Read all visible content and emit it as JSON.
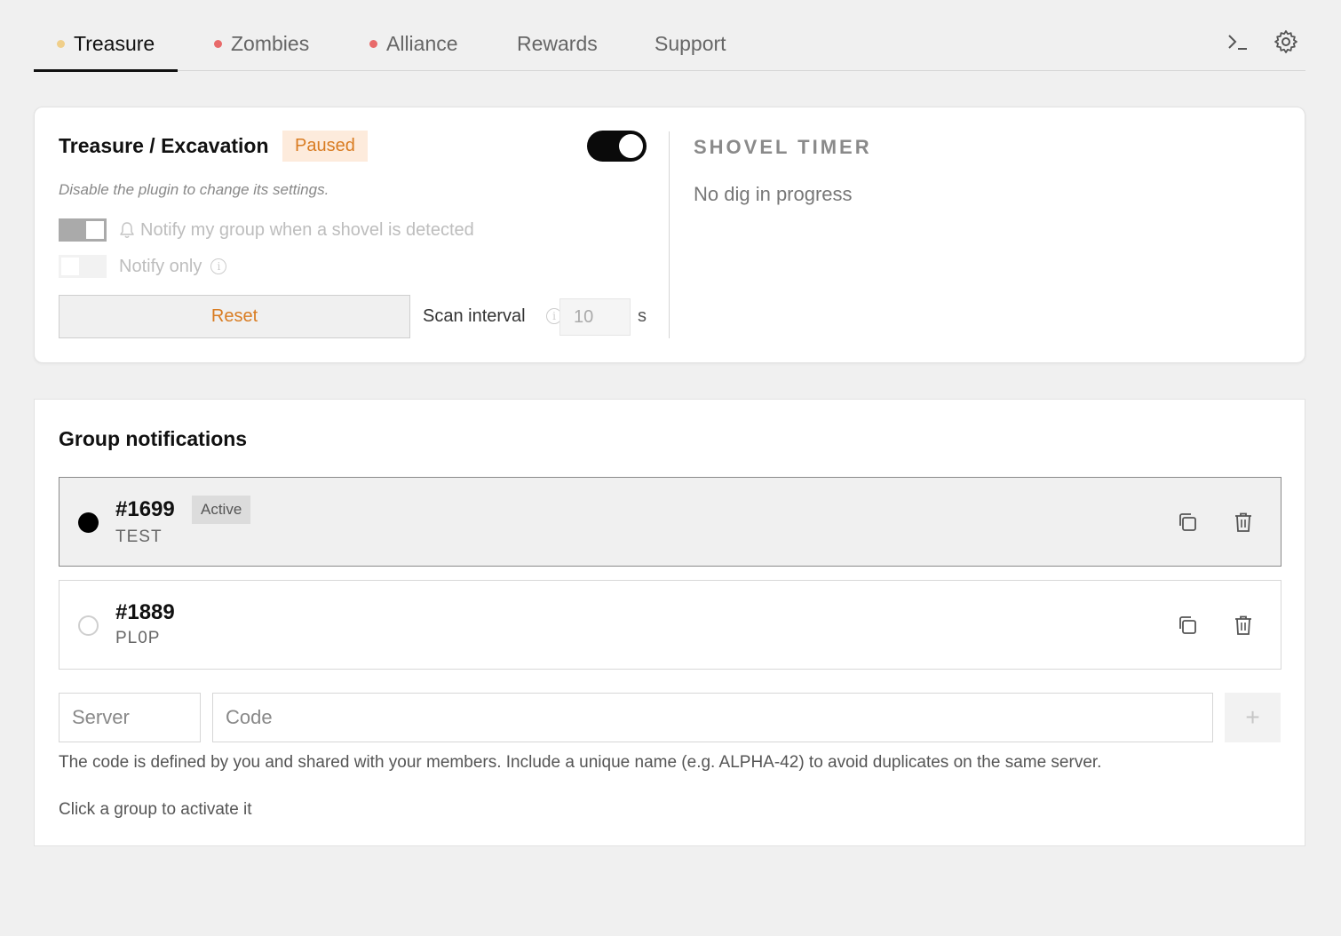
{
  "tabs": [
    {
      "label": "Treasure",
      "dot_color": "#f0cf8a",
      "active": true
    },
    {
      "label": "Zombies",
      "dot_color": "#e86a6a",
      "active": false
    },
    {
      "label": "Alliance",
      "dot_color": "#e86a6a",
      "active": false
    },
    {
      "label": "Rewards",
      "dot_color": null,
      "active": false
    },
    {
      "label": "Support",
      "dot_color": null,
      "active": false
    }
  ],
  "toolbar": {
    "console_icon": "terminal-icon",
    "settings_icon": "gear-icon"
  },
  "treasure": {
    "title": "Treasure / Excavation",
    "status_badge": "Paused",
    "enabled": true,
    "hint": "Disable the plugin to change its settings.",
    "notify_group_label": "Notify my group when a shovel is detected",
    "notify_group_on": true,
    "notify_only_label": "Notify only",
    "notify_only_on": false,
    "reset_label": "Reset",
    "scan_interval_label": "Scan interval",
    "scan_interval_value": "10",
    "scan_interval_unit": "s"
  },
  "shovel_timer": {
    "title": "SHOVEL TIMER",
    "status": "No dig in progress"
  },
  "groups_section": {
    "title": "Group notifications",
    "groups": [
      {
        "number": "#1699",
        "name": "TEST",
        "badge": "Active",
        "active": true
      },
      {
        "number": "#1889",
        "name": "PL0P",
        "badge": "",
        "active": false
      }
    ],
    "server_placeholder": "Server",
    "code_placeholder": "Code",
    "add_label": "+",
    "code_help": "The code is defined by you and shared with your members. Include a unique name (e.g. ALPHA-42) to avoid duplicates on the same server.",
    "click_hint": "Click a group to activate it"
  },
  "colors": {
    "accent": "#d97c22",
    "badge_bg": "#fdebdc",
    "background": "#f0f0f0"
  }
}
